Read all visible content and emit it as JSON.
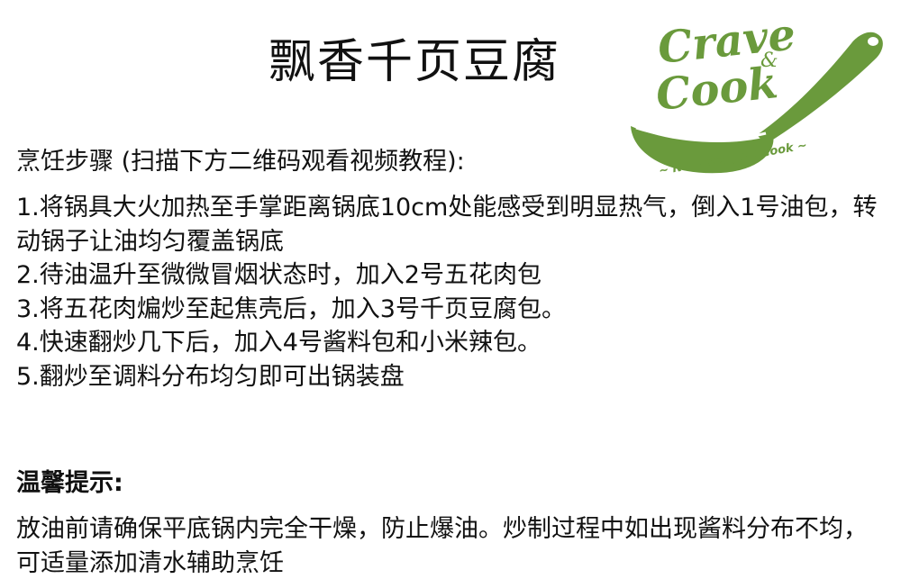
{
  "recipe": {
    "title": "飘香千页豆腐"
  },
  "logo": {
    "line1": "Crave",
    "ampersand": "&",
    "line2": "Cook",
    "tagline": "~ No Prep, Just Cook ~",
    "color": "#6a9a3c"
  },
  "steps": {
    "heading": "烹饪步骤 (扫描下方二维码观看视频教程):",
    "items": [
      "1.将锅具大火加热至手掌距离锅底10cm处能感受到明显热气，倒入1号油包，转动锅子让油均匀覆盖锅底",
      "2.待油温升至微微冒烟状态时，加入2号五花肉包",
      "3.将五花肉煸炒至起焦壳后，加入3号千页豆腐包。",
      "4.快速翻炒几下后，加入4号酱料包和小米辣包。",
      "5.翻炒至调料分布均匀即可出锅装盘"
    ]
  },
  "tip": {
    "heading": "温馨提示:",
    "body": "放油前请确保平底锅内完全干燥，防止爆油。炒制过程中如出现酱料分布不均，可适量添加清水辅助烹饪"
  }
}
